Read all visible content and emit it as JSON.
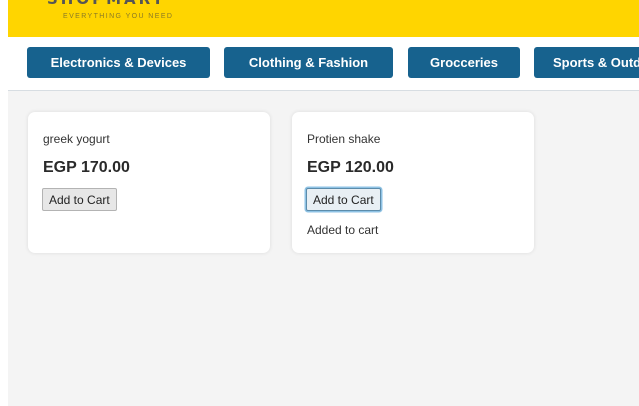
{
  "header": {
    "brand_name": "SHOPMART",
    "tagline": "EVERYTHING YOU NEED",
    "background": "#ffd500"
  },
  "nav": {
    "accent": "#17628e",
    "categories": [
      {
        "label": "Electronics & Devices"
      },
      {
        "label": "Clothing  & Fashion"
      },
      {
        "label": "Grocceries"
      },
      {
        "label": "Sports & Outdoors"
      }
    ]
  },
  "products": [
    {
      "name": "greek yogurt",
      "price": "EGP 170.00",
      "button_label": "Add to Cart",
      "status": ""
    },
    {
      "name": "Protien shake",
      "price": "EGP 120.00",
      "button_label": "Add to Cart",
      "status": "Added to cart"
    }
  ]
}
